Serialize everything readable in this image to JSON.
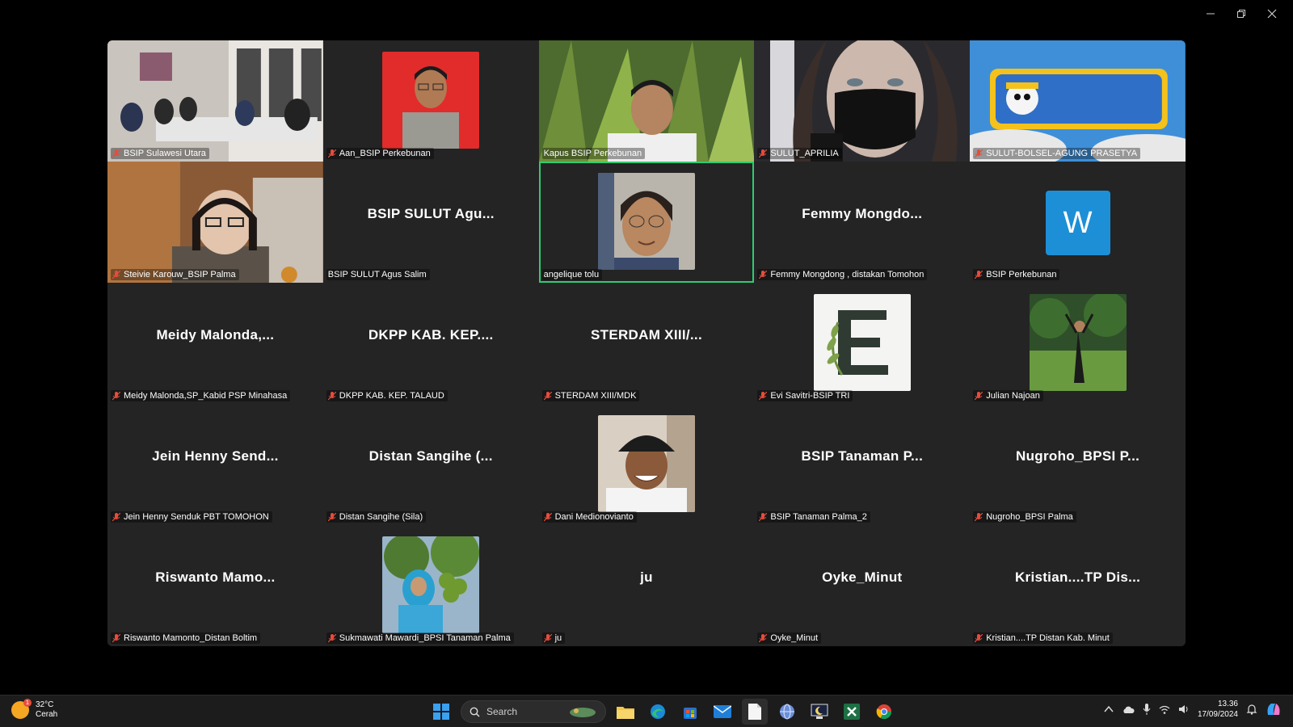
{
  "tiles": [
    {
      "label": "BSIP Sulawesi Utara",
      "big": "",
      "muted": true
    },
    {
      "label": "Aan_BSIP Perkebunan",
      "big": "",
      "muted": true
    },
    {
      "label": "Kapus BSIP Perkebunan",
      "big": "",
      "muted": false
    },
    {
      "label": "SULUT_APRILIA",
      "big": "",
      "muted": true
    },
    {
      "label": "SULUT-BOLSEL-AGUNG PRASETYA",
      "big": "",
      "muted": true
    },
    {
      "label": "Steivie Karouw_BSIP Palma",
      "big": "",
      "muted": true
    },
    {
      "label": "BSIP SULUT Agus Salim",
      "big": "BSIP SULUT Agu...",
      "muted": false
    },
    {
      "label": "angelique tolu",
      "big": "",
      "muted": false
    },
    {
      "label": "Femmy Mongdong , distakan Tomohon",
      "big": "Femmy Mongdo...",
      "muted": true
    },
    {
      "label": "BSIP Perkebunan",
      "big": "W",
      "muted": true
    },
    {
      "label": "Meidy Malonda,SP_Kabid PSP Minahasa",
      "big": "Meidy Malonda,...",
      "muted": true
    },
    {
      "label": "DKPP KAB. KEP. TALAUD",
      "big": "DKPP KAB. KEP....",
      "muted": true
    },
    {
      "label": "STERDAM XIII/MDK",
      "big": "STERDAM XIII/...",
      "muted": true
    },
    {
      "label": "Evi Savitri-BSIP TRI",
      "big": "",
      "muted": true
    },
    {
      "label": "Julian Najoan",
      "big": "",
      "muted": true
    },
    {
      "label": "Jein Henny Senduk PBT TOMOHON",
      "big": "Jein Henny Send...",
      "muted": true
    },
    {
      "label": "Distan Sangihe (Sila)",
      "big": "Distan Sangihe (...",
      "muted": true
    },
    {
      "label": "Dani Medionovianto",
      "big": "",
      "muted": true
    },
    {
      "label": "BSIP Tanaman Palma_2",
      "big": "BSIP Tanaman P...",
      "muted": true
    },
    {
      "label": "Nugroho_BPSI Palma",
      "big": "Nugroho_BPSI P...",
      "muted": true
    },
    {
      "label": "Riswanto Mamonto_Distan Boltim",
      "big": "Riswanto Mamo...",
      "muted": true
    },
    {
      "label": "Sukmawati Mawardi_BPSI Tanaman Palma",
      "big": "",
      "muted": true
    },
    {
      "label": "ju",
      "big": "ju",
      "muted": true
    },
    {
      "label": "Oyke_Minut",
      "big": "Oyke_Minut",
      "muted": true
    },
    {
      "label": "Kristian....TP Distan Kab. Minut",
      "big": "Kristian....TP Dis...",
      "muted": true
    }
  ],
  "taskbar": {
    "weather_temp": "32°C",
    "weather_desc": "Cerah",
    "weather_badge": "1",
    "search_label": "Search",
    "time": "13.36",
    "date": "17/09/2024"
  },
  "colors": {
    "active_border": "#2ecc71",
    "muted_icon": "#e74c3c",
    "tile_bg": "#242424"
  }
}
